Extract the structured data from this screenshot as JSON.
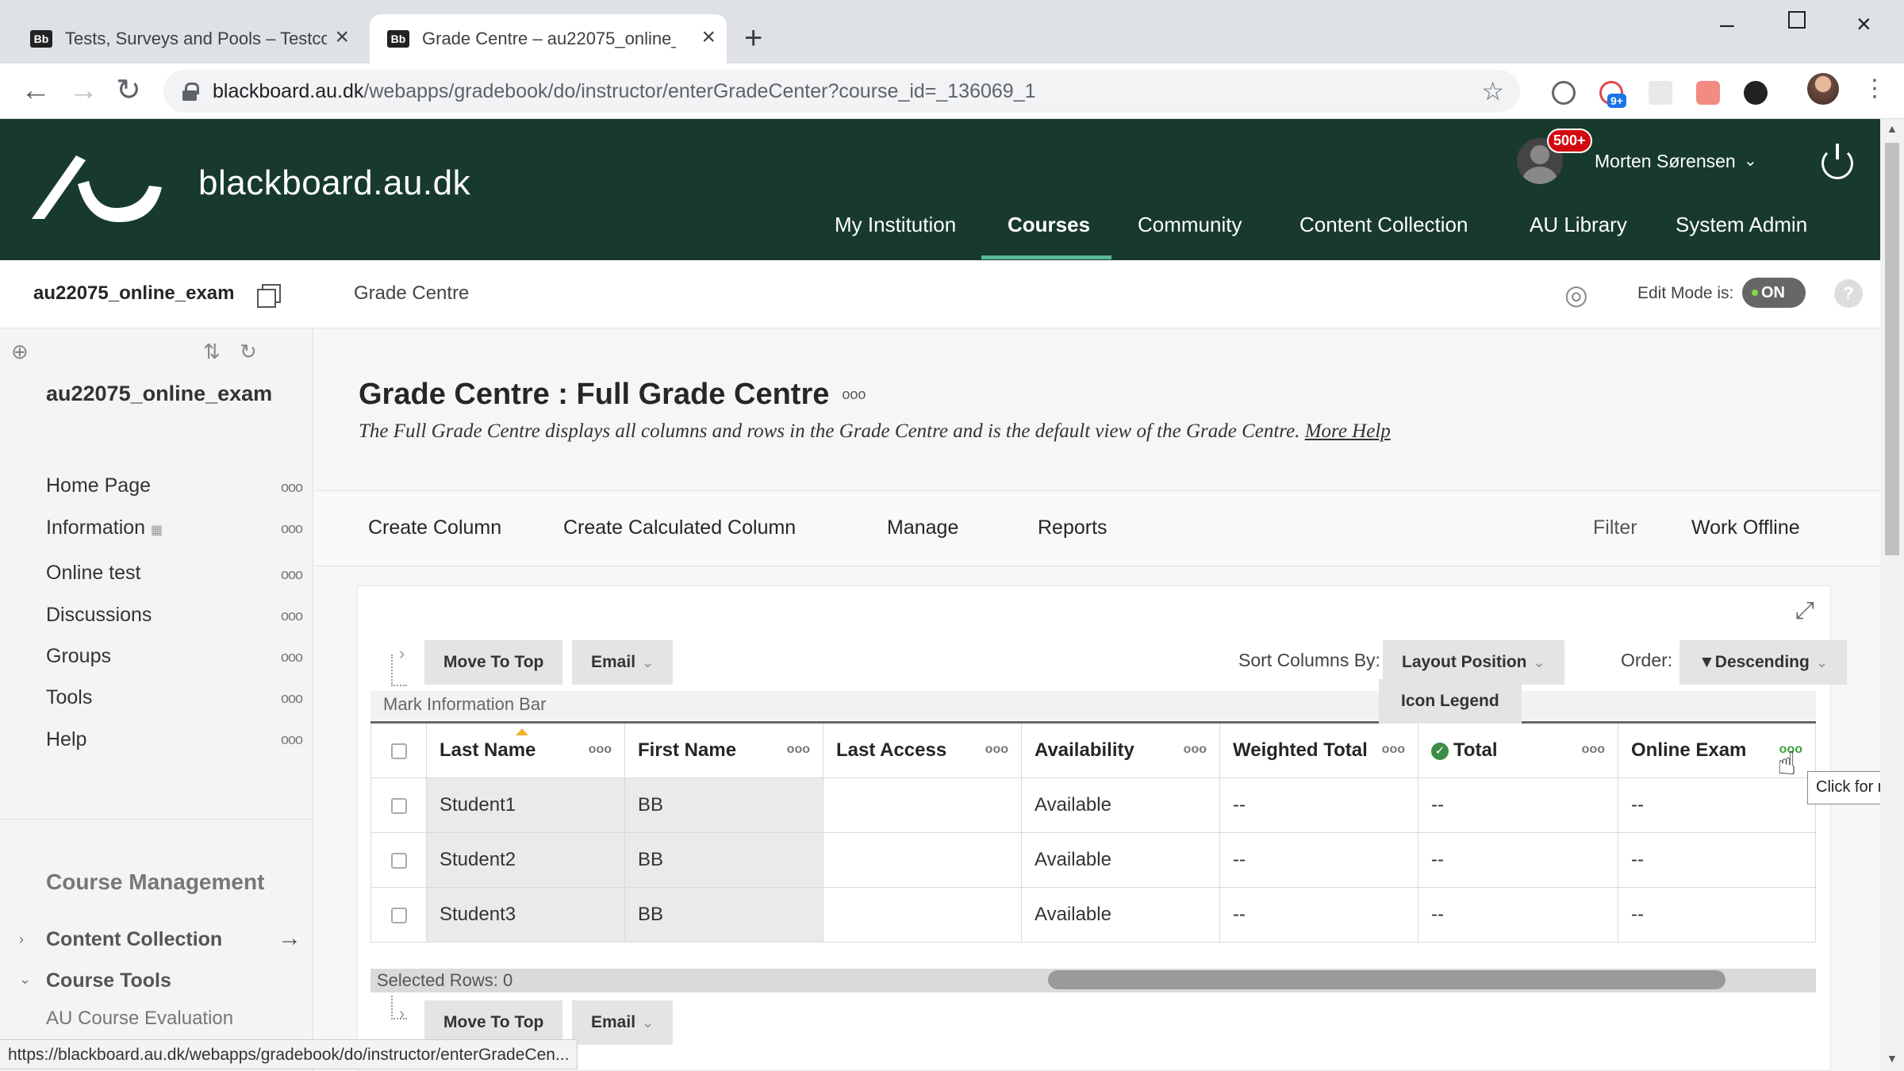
{
  "browser": {
    "tabs": [
      {
        "favicon": "Bb",
        "title": "Tests, Surveys and Pools – Testco"
      },
      {
        "favicon": "Bb",
        "title": "Grade Centre – au22075_online_"
      }
    ],
    "url_host": "blackboard.au.dk",
    "url_path": "/webapps/gradebook/do/instructor/enterGradeCenter?course_id=_136069_1",
    "extension_badge": "9+",
    "status_url": "https://blackboard.au.dk/webapps/gradebook/do/instructor/enterGradeCen..."
  },
  "header": {
    "site_name": "blackboard.au.dk",
    "notification_count": "500+",
    "user_name": "Morten Sørensen",
    "nav": [
      "My Institution",
      "Courses",
      "Community",
      "Content Collection",
      "AU Library",
      "System Admin"
    ],
    "active_nav": "Courses",
    "brand_color": "#173a2c"
  },
  "breadcrumb": {
    "course": "au22075_online_exam",
    "page": "Grade Centre",
    "edit_mode_label": "Edit Mode is:",
    "edit_mode_value": "ON"
  },
  "sidebar": {
    "course_title": "au22075_online_exam",
    "items": [
      "Home Page",
      "Information",
      "Online test",
      "Discussions",
      "Groups",
      "Tools",
      "Help"
    ],
    "section_title": "Course Management",
    "subsections": [
      "Content Collection",
      "Course Tools"
    ],
    "sub_item": "AU Course Evaluation"
  },
  "main": {
    "title": "Grade Centre : Full Grade Centre",
    "description": "The Full Grade Centre displays all columns and rows in the Grade Centre and is the default view of the Grade Centre.",
    "more_help": "More Help",
    "actions": [
      "Create Column",
      "Create Calculated Column",
      "Manage",
      "Reports"
    ],
    "right_actions": [
      "Filter",
      "Work Offline"
    ]
  },
  "grid": {
    "move_to_top": "Move To Top",
    "email": "Email",
    "sort_columns_label": "Sort Columns By:",
    "sort_columns_value": "Layout Position",
    "order_label": "Order:",
    "order_value": "▼Descending",
    "info_bar": "Mark Information Bar",
    "columns": [
      "Last Name",
      "First Name",
      "Last Access",
      "Availability",
      "Weighted Total",
      "Total",
      "Online Exam"
    ],
    "rows": [
      [
        "Student1",
        "BB",
        "",
        "Available",
        "--",
        "--",
        "--"
      ],
      [
        "Student2",
        "BB",
        "",
        "Available",
        "--",
        "--",
        "--"
      ],
      [
        "Student3",
        "BB",
        "",
        "Available",
        "--",
        "--",
        "--"
      ]
    ],
    "selected_rows_label": "Selected Rows: 0",
    "icon_legend": "Icon Legend",
    "tooltip": "Click for mo"
  }
}
